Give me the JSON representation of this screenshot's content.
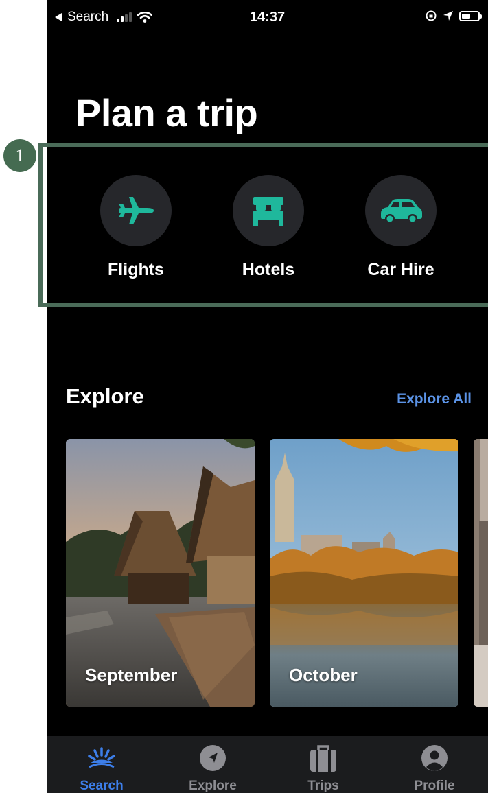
{
  "status_bar": {
    "back_label": "Search",
    "time": "14:37"
  },
  "page": {
    "title": "Plan a trip"
  },
  "annotation": {
    "marker": "1"
  },
  "services": [
    {
      "label": "Flights",
      "icon": "airplane-icon"
    },
    {
      "label": "Hotels",
      "icon": "bed-icon"
    },
    {
      "label": "Car Hire",
      "icon": "car-icon"
    }
  ],
  "explore": {
    "heading": "Explore",
    "link": "Explore All",
    "cards": [
      {
        "caption": "September"
      },
      {
        "caption": "October"
      },
      {
        "caption": ""
      }
    ]
  },
  "tabs": [
    {
      "label": "Search",
      "icon": "search-sunrise-icon",
      "active": true
    },
    {
      "label": "Explore",
      "icon": "compass-icon",
      "active": false
    },
    {
      "label": "Trips",
      "icon": "suitcase-icon",
      "active": false
    },
    {
      "label": "Profile",
      "icon": "user-icon",
      "active": false
    }
  ],
  "colors": {
    "accent_teal": "#1fb89c",
    "link_blue": "#5b93e6",
    "active_tab": "#3d7ee9",
    "highlight_green": "#4a6b58"
  }
}
